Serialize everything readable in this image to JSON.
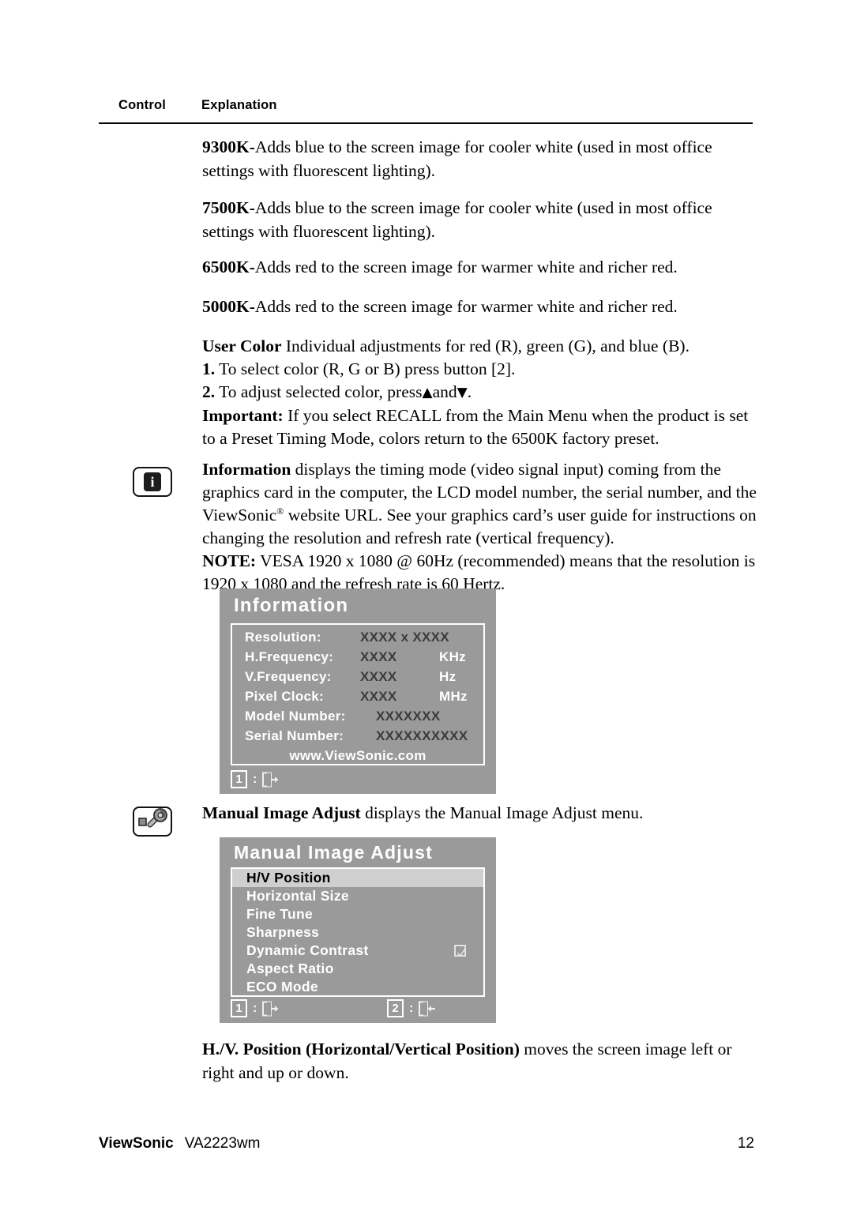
{
  "table_header": {
    "control": "Control",
    "explanation": "Explanation"
  },
  "paragraphs": {
    "p9300k": {
      "term": "9300K-",
      "text": "Adds blue to the screen image for cooler white (used in most office settings with fluorescent lighting)."
    },
    "p7500k": {
      "term": "7500K-",
      "text": "Adds blue to the screen image for cooler white (used in most office settings with fluorescent lighting)."
    },
    "p6500k": {
      "term": "6500K-",
      "text": "Adds red to the screen image for warmer white and richer red."
    },
    "p5000k": {
      "term": "5000K-",
      "text": "Adds red to the screen image for warmer white and richer red."
    },
    "user_color": {
      "term": "User Color",
      "text": "Individual adjustments for red (R), green (G),  and blue (B).",
      "step1_num": "1.",
      "step1_text": "To select color (R, G or B) press button [2].",
      "step2_num": "2.",
      "step2_text_a": "To adjust selected color, press",
      "step2_up": "▲",
      "step2_and": "and",
      "step2_down": "▼",
      "step2_text_b": ".",
      "important_term": "Important:",
      "important_text": "If you select RECALL from the Main Menu when the product is set to a Preset Timing Mode, colors return to the 6500K factory preset."
    },
    "information": {
      "term": "Information",
      "text_a": "displays the timing mode (video signal input) coming from the graphics card in the computer, the LCD model number, the serial number, and the ViewSonic",
      "registered": "®",
      "text_b": "website URL. See your graphics card’s user guide for instructions on changing the resolution and refresh rate (vertical frequency).",
      "note_term": "NOTE:",
      "note_text": "VESA 1920 x 1080 @ 60Hz (recommended) means that the resolution is 1920 x 1080 and the refresh rate is 60 Hertz."
    },
    "manual_image_adjust": {
      "term": "Manual Image Adjust",
      "text": "displays the Manual Image Adjust menu."
    },
    "hv_position": {
      "term": "H./V. Position (Horizontal/Vertical Position)",
      "text": "moves the screen image left or right and up or down."
    }
  },
  "osd_information": {
    "title": "Information",
    "rows": [
      {
        "label": "Resolution:",
        "value": "XXXX x XXXX",
        "unit": ""
      },
      {
        "label": "H.Frequency:",
        "value": "XXXX",
        "unit": "KHz"
      },
      {
        "label": "V.Frequency:",
        "value": "XXXX",
        "unit": "Hz"
      },
      {
        "label": "Pixel Clock:",
        "value": "XXXX",
        "unit": "MHz"
      },
      {
        "label": "Model Number:",
        "value": "XXXXXXX",
        "unit": ""
      },
      {
        "label": "Serial Number:",
        "value": "XXXXXXXXXX",
        "unit": ""
      }
    ],
    "url": "www.ViewSonic.com",
    "hint_key": "1",
    "hint_colon": ":",
    "hint_icon": "exit-icon"
  },
  "osd_manual_image_adjust": {
    "title": "Manual Image Adjust",
    "items": [
      {
        "label": "H/V Position",
        "selected": true,
        "checkbox": false
      },
      {
        "label": "Horizontal Size",
        "selected": false,
        "checkbox": false
      },
      {
        "label": "Fine Tune",
        "selected": false,
        "checkbox": false
      },
      {
        "label": "Sharpness",
        "selected": false,
        "checkbox": false
      },
      {
        "label": "Dynamic Contrast",
        "selected": false,
        "checkbox": true
      },
      {
        "label": "Aspect Ratio",
        "selected": false,
        "checkbox": false
      },
      {
        "label": "ECO Mode",
        "selected": false,
        "checkbox": false
      }
    ],
    "hint1_key": "1",
    "hint1_colon": ":",
    "hint1_icon": "exit-icon",
    "hint2_key": "2",
    "hint2_colon": ":",
    "hint2_icon": "enter-icon"
  },
  "footer": {
    "brand": "ViewSonic",
    "model": "VA2223wm",
    "page": "12"
  },
  "colors": {
    "osd_background": "#9a9a9a",
    "osd_selected_row": "#cfcfcf",
    "osd_value_text": "#3b3b3b",
    "page_text": "#000000"
  }
}
